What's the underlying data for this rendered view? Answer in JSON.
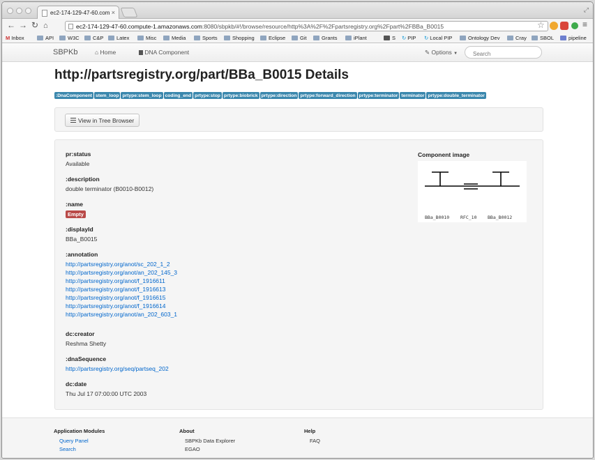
{
  "browser": {
    "tab_title": "ec2-174-129-47-60.com",
    "tab_close": "×",
    "url_host": "ec2-174-129-47-60.compute-1.amazonaws.com",
    "url_rest": ":8080/sbpkb/#!/browse/resource/http%3A%2F%2Fpartsregistry.org%2Fpart%2FBBa_B0015",
    "bookmarks": [
      "Inbox",
      "API",
      "W3C",
      "C&P",
      "Latex",
      "Misc",
      "Media",
      "Sports",
      "Shopping",
      "Eclipse",
      "Git",
      "Grants",
      "iPlant",
      "S",
      "PIP",
      "Local PIP",
      "Ontology Dev",
      "Cray",
      "SBOL",
      "pipeline"
    ]
  },
  "navbar": {
    "brand": "SBPKb",
    "home": "Home",
    "dna_component": "DNA Component",
    "options": "Options",
    "search_placeholder": "Search"
  },
  "page": {
    "title": "http://partsregistry.org/part/BBa_B0015 Details",
    "labels": [
      ":DnaComponent",
      "stem_loop",
      "prtype:stem_loop",
      "coding_end",
      "prtype:stop",
      "prtype:biobrick",
      "prtype:direction",
      "prtype:forward_direction",
      "prtype:terminator",
      "terminator",
      "prtype:double_terminator"
    ],
    "tree_button": "View in Tree Browser",
    "properties": {
      "status": {
        "key": "pr:status",
        "value": "Available"
      },
      "description": {
        "key": ":description",
        "value": "double terminator (B0010-B0012)"
      },
      "name": {
        "key": ":name",
        "badge": "Empty"
      },
      "displayid": {
        "key": ":displayId",
        "value": "BBa_B0015"
      },
      "annotation": {
        "key": ":annotation",
        "links": [
          "http://partsregistry.org/anot/sc_202_1_2",
          "http://partsregistry.org/anot/an_202_145_3",
          "http://partsregistry.org/anot/f_1916611",
          "http://partsregistry.org/anot/f_1916613",
          "http://partsregistry.org/anot/f_1916615",
          "http://partsregistry.org/anot/f_1916614",
          "http://partsregistry.org/anot/an_202_603_1"
        ]
      },
      "creator": {
        "key": "dc:creator",
        "value": "Reshma Shetty"
      },
      "sequence": {
        "key": ":dnaSequence",
        "link": "http://partsregistry.org/seq/partseq_202"
      },
      "date": {
        "key": "dc:date",
        "value": "Thu Jul 17 07:00:00 UTC 2003"
      }
    },
    "component_image": {
      "title": "Component image",
      "parts": [
        "BBa_B0010",
        "RFC_10",
        "BBa_B0012"
      ]
    }
  },
  "footer": {
    "modules_heading": "Application Modules",
    "modules": [
      "Query Panel",
      "Search"
    ],
    "about_heading": "About",
    "about": [
      "SBPKb Data Explorer",
      "EGAO"
    ],
    "help_heading": "Help",
    "help": [
      "FAQ"
    ]
  }
}
